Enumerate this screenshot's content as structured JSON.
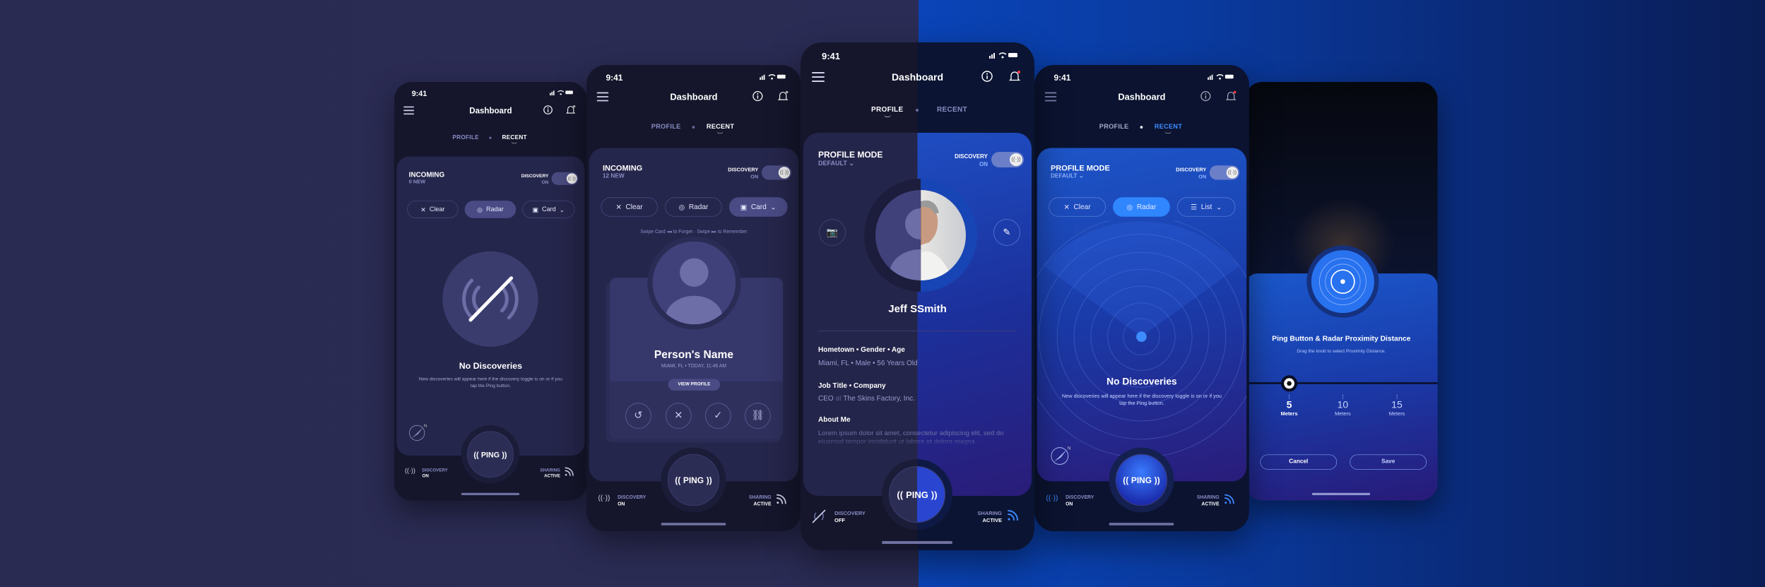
{
  "status_time": "9:41",
  "header_title": "Dashboard",
  "tabs": {
    "profile": "PROFILE",
    "recent": "RECENT"
  },
  "discovery": {
    "label": "DISCOVERY",
    "on": "ON"
  },
  "buttons": {
    "clear": "Clear",
    "radar": "Radar",
    "card": "Card",
    "list": "List"
  },
  "ping": "PING",
  "bottom": {
    "discovery": "DISCOVERY",
    "on": "ON",
    "off": "OFF",
    "sharing": "SHARING",
    "active": "ACTIVE"
  },
  "empty": {
    "title": "No Discoveries",
    "desc": "New discoveries will appear here if the discovery toggle is on or if you tap the Ping button."
  },
  "phone1": {
    "title": "INCOMING",
    "sub": "0 NEW"
  },
  "phone2": {
    "title": "INCOMING",
    "sub": "12 NEW",
    "swipe": {
      "a": "Swipe Card",
      "b": "to Forget",
      "c": "Swipe",
      "d": "to Remember"
    },
    "person": {
      "name": "Person's Name",
      "meta": "MIAMI, FL  •  TODAY, 11:46 AM",
      "view": "VIEW PROFILE"
    }
  },
  "phone3": {
    "title": "PROFILE MODE",
    "sub": "DEFAULT",
    "name": "Jeff SSmith",
    "hometown_label": "Hometown  •  Gender  •  Age",
    "hometown_value": "Miami, FL  •  Male  •  56 Years Old",
    "job_label": "Job Title  •  Company",
    "job_title": "CEO",
    "job_at": "at",
    "job_company": "The Skins Factory, Inc.",
    "about_label": "About Me",
    "about_text": "Lorem ipsum dolor sit amet, consectetur adipiscing elit, sed do eiusmod tempor incididunt ut labore et dolore magna"
  },
  "phone4": {
    "title": "PROFILE MODE",
    "sub": "DEFAULT"
  },
  "phone5": {
    "title": "Ping Button & Radar Proximity Distance",
    "sub": "Drag the knob to select Proximity Distance.",
    "distances": [
      {
        "value": "5",
        "unit": "Meters"
      },
      {
        "value": "10",
        "unit": "Meters"
      },
      {
        "value": "15",
        "unit": "Meters"
      }
    ],
    "selected_meters": 5,
    "cancel": "Cancel",
    "save": "Save"
  },
  "colors": {
    "dark_bg": "#2a2b52",
    "blue_bg": "#0a44b8",
    "accent_blue": "#2f86ff",
    "card_dark": "#25264b",
    "notification": "#ff3b4a"
  }
}
